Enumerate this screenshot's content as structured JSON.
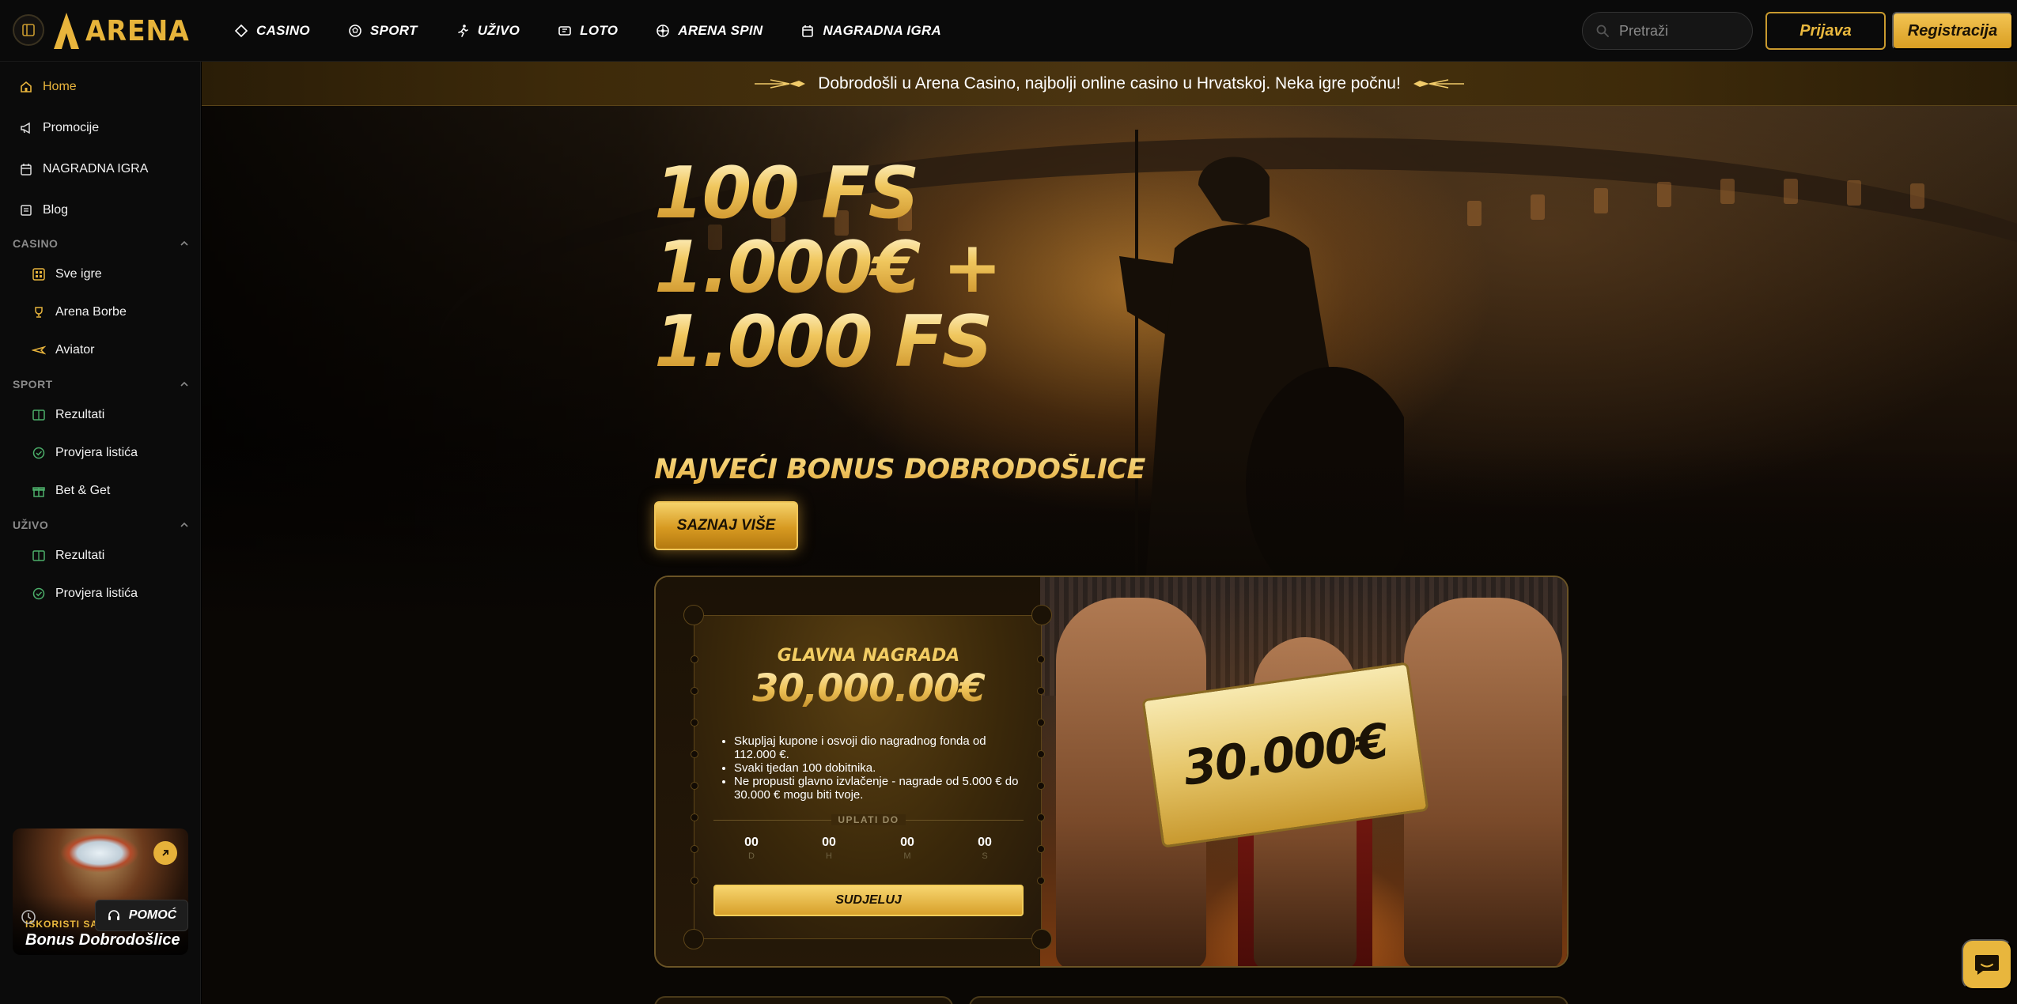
{
  "brand": {
    "name": "ARENA",
    "accent": "#e8b43c"
  },
  "topnav": {
    "items": [
      {
        "label": "CASINO",
        "icon": "diamond-icon"
      },
      {
        "label": "SPORT",
        "icon": "soccer-ball-icon"
      },
      {
        "label": "UŽIVO",
        "icon": "running-icon"
      },
      {
        "label": "LOTO",
        "icon": "ticket-icon"
      },
      {
        "label": "ARENA SPIN",
        "icon": "spin-wheel-icon"
      },
      {
        "label": "NAGRADNA IGRA",
        "icon": "calendar-gift-icon"
      }
    ],
    "search_placeholder": "Pretraži",
    "login_label": "Prijava",
    "register_label": "Registracija"
  },
  "sidebar": {
    "top_items": [
      {
        "label": "Home",
        "icon": "home-icon",
        "active": true
      },
      {
        "label": "Promocije",
        "icon": "megaphone-icon"
      },
      {
        "label": "NAGRADNA IGRA",
        "icon": "calendar-gift-icon"
      },
      {
        "label": "Blog",
        "icon": "blog-icon"
      }
    ],
    "sections": [
      {
        "title": "CASINO",
        "items": [
          {
            "label": "Sve igre",
            "icon": "grid-icon"
          },
          {
            "label": "Arena Borbe",
            "icon": "trophy-icon"
          },
          {
            "label": "Aviator",
            "icon": "plane-icon"
          }
        ]
      },
      {
        "title": "SPORT",
        "items": [
          {
            "label": "Rezultati",
            "icon": "scoreboard-icon"
          },
          {
            "label": "Provjera listića",
            "icon": "check-ticket-icon"
          },
          {
            "label": "Bet & Get",
            "icon": "gift-icon"
          }
        ]
      },
      {
        "title": "UŽIVO",
        "items": [
          {
            "label": "Rezultati",
            "icon": "scoreboard-icon"
          },
          {
            "label": "Provjera listića",
            "icon": "check-ticket-icon"
          }
        ]
      }
    ],
    "promo": {
      "kicker": "ISKORISTI SADA",
      "title": "Bonus Dobrodošlice"
    },
    "help_label": "POMOĆ"
  },
  "ticker": {
    "text": "Dobrodošli u Arena Casino, najbolji online casino u Hrvatskoj. Neka igre počnu!"
  },
  "hero": {
    "lines": [
      "100 FS",
      "1.000€ +",
      "1.000 FS"
    ],
    "subtitle": "NAJVEĆI BONUS DOBRODOŠLICE",
    "cta_label": "SAZNAJ VIŠE"
  },
  "raffle": {
    "title": "GLAVNA NAGRADA",
    "amount": "30,000.00€",
    "bullets": [
      "Skupljaj kupone i osvoji dio nagradnog fonda od 112.000 €.",
      "Svaki tjedan 100 dobitnika.",
      "Ne propusti glavno izvlačenje - nagrade od 5.000 € do 30.000 € mogu biti tvoje."
    ],
    "deposit_label": "UPLATI DO",
    "countdown": [
      {
        "value": "00",
        "unit": "D"
      },
      {
        "value": "00",
        "unit": "H"
      },
      {
        "value": "00",
        "unit": "M"
      },
      {
        "value": "00",
        "unit": "S"
      }
    ],
    "join_label": "SUDJELUJ",
    "check_amount": "30.000€"
  }
}
